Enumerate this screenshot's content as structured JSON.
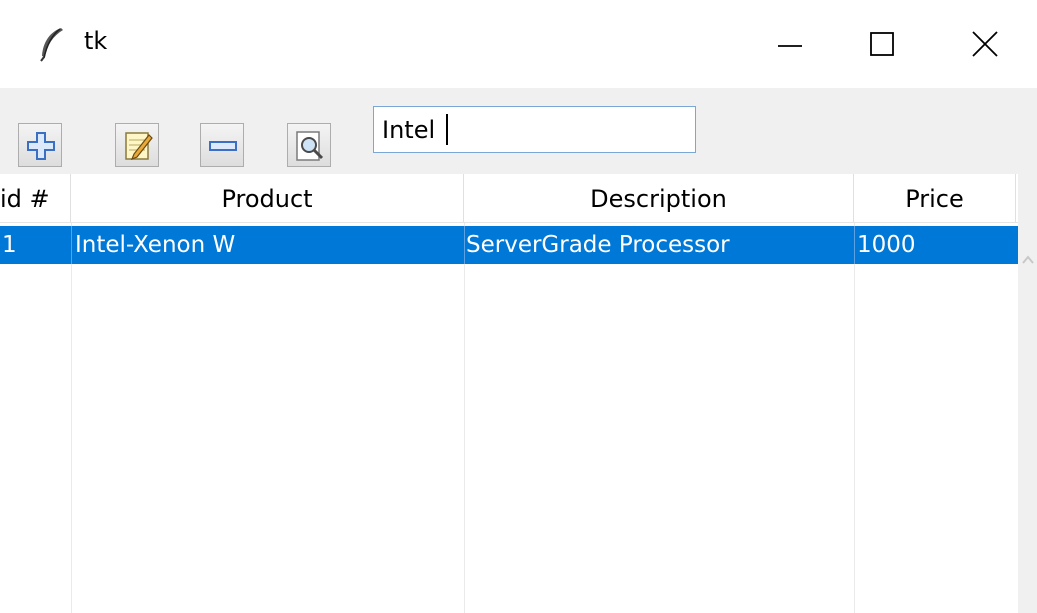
{
  "window": {
    "title": "tk",
    "icons": {
      "app": "feather-icon",
      "minimize": "minimize-icon",
      "maximize": "maximize-icon",
      "close": "close-icon"
    }
  },
  "toolbar": {
    "buttons": [
      {
        "name": "add",
        "icon": "plus-icon"
      },
      {
        "name": "edit",
        "icon": "edit-notepad-icon"
      },
      {
        "name": "remove",
        "icon": "minus-icon"
      },
      {
        "name": "search",
        "icon": "magnifier-document-icon"
      }
    ],
    "search": {
      "value": "Intel"
    }
  },
  "table": {
    "columns": [
      "id #",
      "Product",
      "Description",
      "Price"
    ],
    "rows": [
      {
        "id": "1",
        "product": "Intel-Xenon W",
        "description": "ServerGrade Processor",
        "price": "1000",
        "selected": true
      }
    ]
  },
  "colors": {
    "selection": "#0078d7",
    "selection_text": "#ffffff",
    "toolbar_bg": "#f0f0f0",
    "input_border": "#7aa7d6"
  }
}
